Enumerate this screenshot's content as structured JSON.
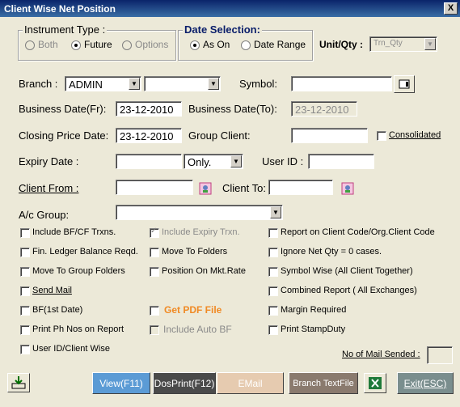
{
  "window": {
    "title": "Client Wise Net Position",
    "close": "X"
  },
  "instrument": {
    "legend": "Instrument Type :",
    "options": [
      "Both",
      "Future",
      "Options"
    ],
    "selected": "Future"
  },
  "date_selection": {
    "legend": "Date Selection:",
    "options": [
      "As On",
      "Date Range"
    ],
    "selected": "As On"
  },
  "unit": {
    "label": "Unit/Qty :",
    "value": "Trn_Qty"
  },
  "branch": {
    "label": "Branch :",
    "value": "ADMIN",
    "value2": ""
  },
  "symbol": {
    "label": "Symbol:",
    "value": ""
  },
  "business_date_fr": {
    "label": "Business Date(Fr):",
    "value": "23-12-2010"
  },
  "business_date_to": {
    "label": "Business Date(To):",
    "value": "23-12-2010"
  },
  "closing_price": {
    "label": "Closing Price Date:",
    "value": "23-12-2010"
  },
  "group_client": {
    "label": "Group Client:",
    "value": "",
    "consolidated": "Consolidated"
  },
  "expiry": {
    "label": "Expiry Date :",
    "value": "",
    "mode": "Only."
  },
  "user_id": {
    "label": "User ID :",
    "value": ""
  },
  "client_from": {
    "label": "Client From :",
    "value": ""
  },
  "client_to": {
    "label": "Client To:",
    "value": ""
  },
  "ac_group": {
    "label": "A/c Group:",
    "value": ""
  },
  "checks": {
    "include_bf": "Include BF/CF Trxns.",
    "include_expiry": "Include Expiry Trxn.",
    "report_client_code": "Report on Client Code/Org.Client Code",
    "fin_ledger": "Fin. Ledger Balance Reqd.",
    "move_folders": "Move To Folders",
    "ignore_net": "Ignore Net Qty = 0 cases.",
    "move_group": "Move To Group Folders",
    "position_mkt": "Position On Mkt.Rate",
    "symbol_wise": "Symbol Wise (All Client Together)",
    "send_mail": "Send Mail",
    "combined": "Combined Report ( All Exchanges)",
    "bf_first": "BF(1st Date)",
    "get_pdf": "Get PDF File",
    "margin": "Margin Required",
    "print_ph": "Print Ph Nos on Report",
    "include_auto_bf": "Include Auto BF",
    "print_stamp": "Print StampDuty",
    "user_client": "User ID/Client Wise"
  },
  "mail_count": {
    "label": "No of Mail Sended :",
    "value": ""
  },
  "buttons": {
    "view": "View(F11)",
    "dosprint": "DosPrint(F12)",
    "email": "EMail",
    "branch_text": "Branch TextFile",
    "exit": "Exit(ESC)"
  },
  "colors": {
    "view": "#5b9bd5",
    "dosprint": "#4a4a4a",
    "email": "#e6cbb0",
    "branch_text": "#8a7a6e",
    "exit": "#7a8e8e",
    "pdf": "#f08a24"
  }
}
